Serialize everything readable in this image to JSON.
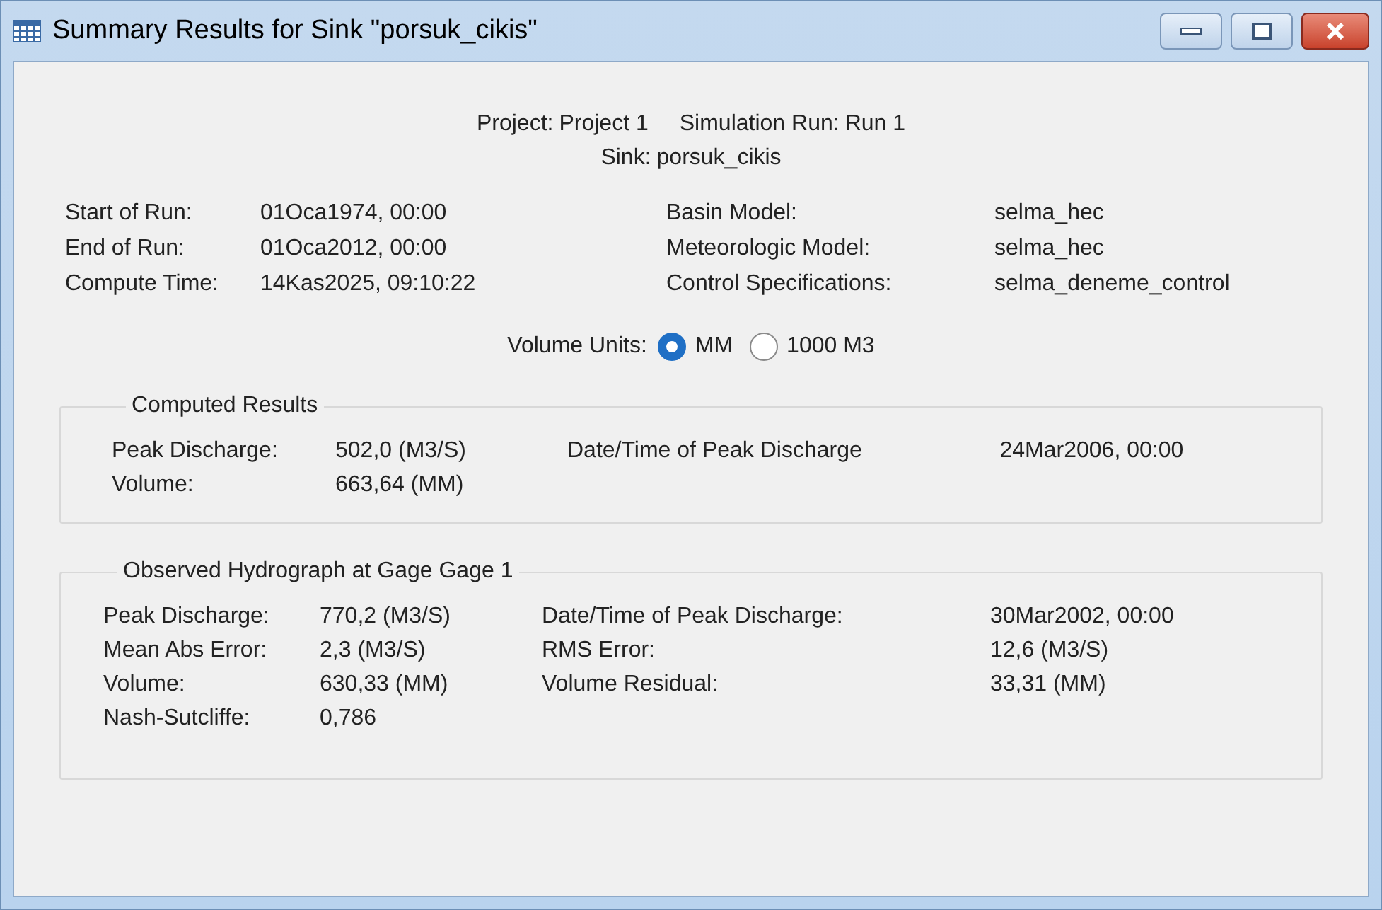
{
  "window": {
    "title": "Summary Results for Sink \"porsuk_cikis\""
  },
  "header": {
    "project_label": "Project:",
    "project": "Project 1",
    "run_label": "Simulation Run:",
    "run": "Run 1",
    "sink_label": "Sink:",
    "sink": "porsuk_cikis"
  },
  "run_info": {
    "left": [
      {
        "label": "Start of Run:",
        "value": "01Oca1974, 00:00"
      },
      {
        "label": "End of Run:",
        "value": "01Oca2012, 00:00"
      },
      {
        "label": "Compute Time:",
        "value": "14Kas2025, 09:10:22"
      }
    ],
    "right": [
      {
        "label": "Basin Model:",
        "value": "selma_hec"
      },
      {
        "label": "Meteorologic Model:",
        "value": "selma_hec"
      },
      {
        "label": "Control Specifications:",
        "value": "selma_deneme_control"
      }
    ]
  },
  "volume_units": {
    "label": "Volume Units:",
    "options": [
      {
        "label": "MM",
        "selected": true
      },
      {
        "label": "1000 M3",
        "selected": false
      }
    ]
  },
  "computed_results": {
    "title": "Computed Results",
    "left": [
      {
        "label": "Peak Discharge:",
        "value": "502,0 (M3/S)"
      },
      {
        "label": "Volume:",
        "value": "663,64 (MM)"
      }
    ],
    "right": [
      {
        "label": "Date/Time of Peak Discharge",
        "value": "24Mar2006, 00:00"
      }
    ]
  },
  "observed_hydrograph": {
    "title": "Observed Hydrograph at Gage Gage 1",
    "left": [
      {
        "label": "Peak Discharge:",
        "value": "770,2 (M3/S)"
      },
      {
        "label": "Mean Abs Error:",
        "value": "2,3 (M3/S)"
      },
      {
        "label": "Volume:",
        "value": "630,33 (MM)"
      },
      {
        "label": "Nash-Sutcliffe:",
        "value": "0,786"
      }
    ],
    "right": [
      {
        "label": "Date/Time of Peak Discharge:",
        "value": "30Mar2002, 00:00"
      },
      {
        "label": "RMS Error:",
        "value": "12,6 (M3/S)"
      },
      {
        "label": "Volume Residual:",
        "value": "33,31 (MM)"
      }
    ]
  }
}
